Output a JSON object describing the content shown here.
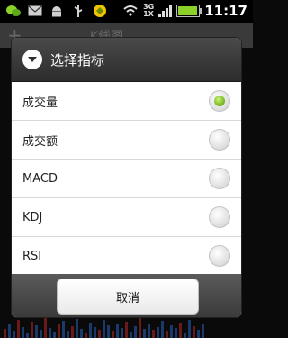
{
  "status_bar": {
    "network_label": "3G",
    "network_sub_label": "1X",
    "time": "11:17",
    "battery_level": 0.85,
    "icons": [
      "wechat-icon",
      "mail-icon",
      "android-icon",
      "usb-icon",
      "app-icon",
      "wifi-icon",
      "signal-icon",
      "battery-icon"
    ]
  },
  "background_app": {
    "title": "K线图"
  },
  "dialog": {
    "title": "选择指标",
    "options": [
      {
        "label": "成交量",
        "selected": true
      },
      {
        "label": "成交额",
        "selected": false
      },
      {
        "label": "MACD",
        "selected": false
      },
      {
        "label": "KDJ",
        "selected": false
      },
      {
        "label": "RSI",
        "selected": false
      }
    ],
    "cancel_label": "取消"
  },
  "colors": {
    "selected_radio": "#6fb31a",
    "title_bar": "#2c2c2c"
  }
}
